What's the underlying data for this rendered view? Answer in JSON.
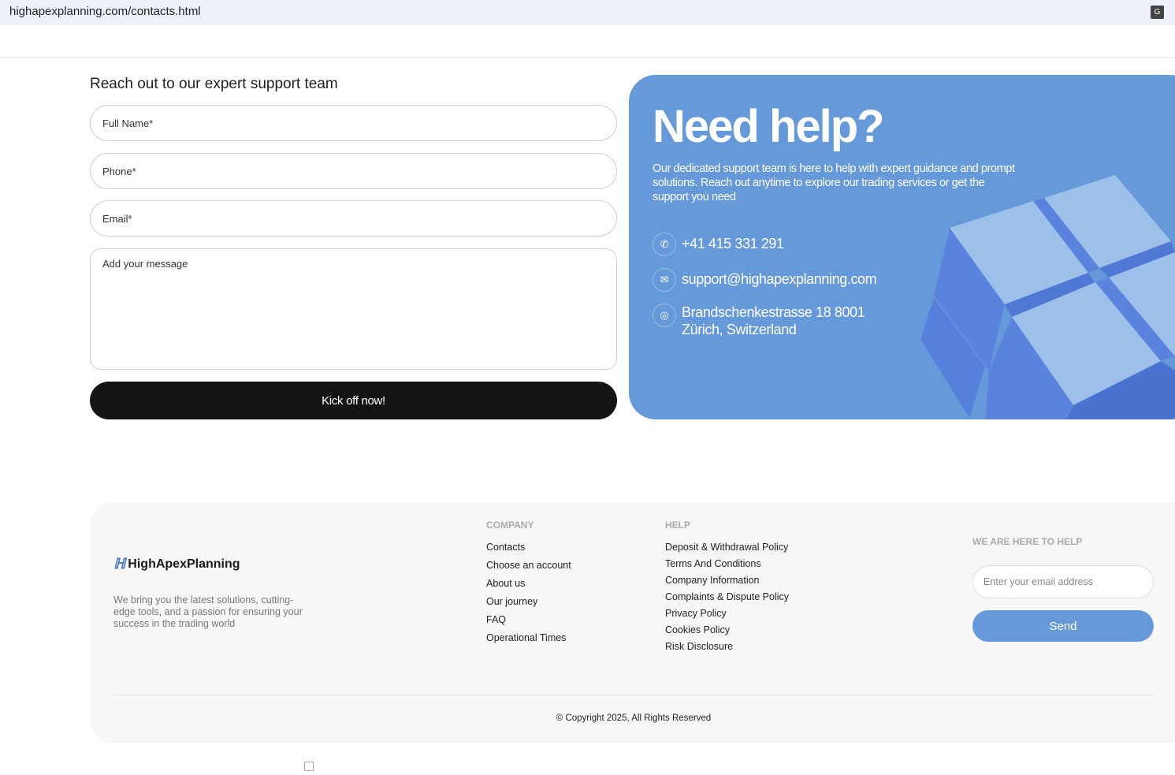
{
  "browser": {
    "url": "highapexplanning.com/contacts.html",
    "translate_icon": "translate-icon"
  },
  "form": {
    "title": "Reach out to our expert support team",
    "full_name_placeholder": "Full Name*",
    "phone_placeholder": "Phone*",
    "email_placeholder": "Email*",
    "message_placeholder": "Add your message",
    "submit_label": "Kick off now!"
  },
  "help": {
    "title": "Need help?",
    "description": "Our dedicated support team is here to help with expert guidance and prompt solutions. Reach out anytime to explore our trading services or get the support you need",
    "phone": "+41 415 331 291",
    "email": "support@highapexplanning.com",
    "address_line1": "Brandschenkestrasse 18 8001",
    "address_line2": "Zürich, Switzerland",
    "colors": {
      "panel": "#6699d9"
    }
  },
  "footer": {
    "brand": "HighApexPlanning",
    "about": "We bring you the latest solutions, cutting-edge tools, and a passion for ensuring your success in the trading world",
    "company": {
      "heading": "COMPANY",
      "links": [
        "Contacts",
        "Choose an account",
        "About us",
        "Our journey",
        "FAQ",
        "Operational Times"
      ]
    },
    "help": {
      "heading": "HELP",
      "links": [
        "Deposit & Withdrawal Policy",
        "Terms And Conditions",
        "Company Information",
        "Complaints & Dispute Policy",
        "Privacy Policy",
        "Cookies Policy",
        "Risk Disclosure"
      ]
    },
    "newsletter": {
      "heading": "WE ARE HERE TO HELP",
      "email_placeholder": "Enter your email address",
      "send_label": "Send"
    },
    "copyright": "© Copyright 2025, All Rights Reserved"
  }
}
